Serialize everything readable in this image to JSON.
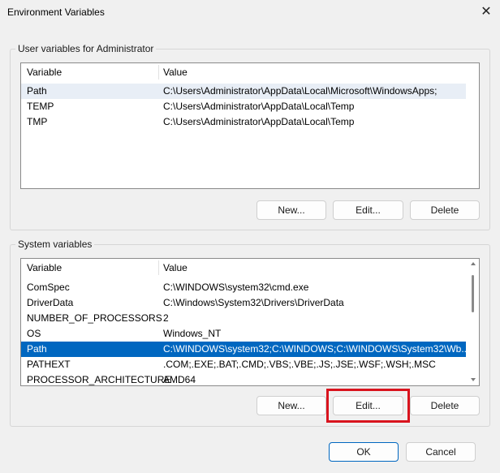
{
  "window": {
    "title": "Environment Variables",
    "close_glyph": "✕"
  },
  "user_section": {
    "legend": "User variables for Administrator",
    "columns": [
      "Variable",
      "Value"
    ],
    "rows": [
      {
        "variable": "Path",
        "value": "C:\\Users\\Administrator\\AppData\\Local\\Microsoft\\WindowsApps;"
      },
      {
        "variable": "TEMP",
        "value": "C:\\Users\\Administrator\\AppData\\Local\\Temp"
      },
      {
        "variable": "TMP",
        "value": "C:\\Users\\Administrator\\AppData\\Local\\Temp"
      }
    ],
    "buttons": {
      "new": "New...",
      "edit": "Edit...",
      "delete": "Delete"
    }
  },
  "system_section": {
    "legend": "System variables",
    "columns": [
      "Variable",
      "Value"
    ],
    "rows": [
      {
        "variable": "ComSpec",
        "value": "C:\\WINDOWS\\system32\\cmd.exe"
      },
      {
        "variable": "DriverData",
        "value": "C:\\Windows\\System32\\Drivers\\DriverData"
      },
      {
        "variable": "NUMBER_OF_PROCESSORS",
        "value": "2"
      },
      {
        "variable": "OS",
        "value": "Windows_NT"
      },
      {
        "variable": "Path",
        "value": "C:\\WINDOWS\\system32;C:\\WINDOWS;C:\\WINDOWS\\System32\\Wb..."
      },
      {
        "variable": "PATHEXT",
        "value": ".COM;.EXE;.BAT;.CMD;.VBS;.VBE;.JS;.JSE;.WSF;.WSH;.MSC"
      },
      {
        "variable": "PROCESSOR_ARCHITECTURE",
        "value": "AMD64"
      }
    ],
    "selected_row_variable": "Path",
    "buttons": {
      "new": "New...",
      "edit": "Edit...",
      "delete": "Delete"
    }
  },
  "footer": {
    "ok": "OK",
    "cancel": "Cancel"
  },
  "colors": {
    "selection": "#0067c0",
    "annotation_highlight": "#d9141e"
  }
}
